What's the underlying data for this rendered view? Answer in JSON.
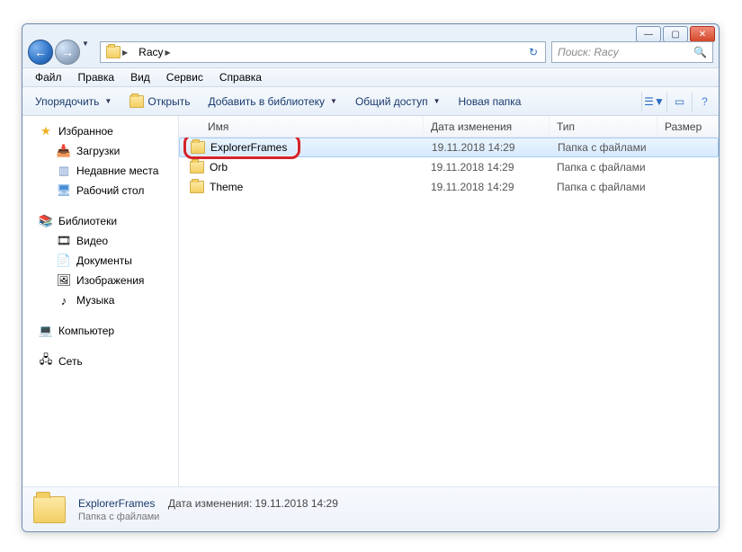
{
  "titlebar": {
    "min": "—",
    "max": "▢",
    "close": "✕"
  },
  "address": {
    "folder": "Racy",
    "refresh_glyph": "↻"
  },
  "search": {
    "placeholder": "Поиск: Racy",
    "icon": "🔍"
  },
  "menu": {
    "file": "Файл",
    "edit": "Правка",
    "view": "Вид",
    "tools": "Сервис",
    "help": "Справка"
  },
  "toolbar": {
    "organize": "Упорядочить",
    "open": "Открыть",
    "add_library": "Добавить в библиотеку",
    "share": "Общий доступ",
    "new_folder": "Новая папка"
  },
  "nav": {
    "favorites": "Избранное",
    "downloads": "Загрузки",
    "recent": "Недавние места",
    "desktop": "Рабочий стол",
    "libraries": "Библиотеки",
    "video": "Видео",
    "documents": "Документы",
    "pictures": "Изображения",
    "music": "Музыка",
    "computer": "Компьютер",
    "network": "Сеть"
  },
  "columns": {
    "name": "Имя",
    "date": "Дата изменения",
    "type": "Тип",
    "size": "Размер"
  },
  "rows": [
    {
      "name": "ExplorerFrames",
      "date": "19.11.2018 14:29",
      "type": "Папка с файлами",
      "selected": true
    },
    {
      "name": "Orb",
      "date": "19.11.2018 14:29",
      "type": "Папка с файлами",
      "selected": false
    },
    {
      "name": "Theme",
      "date": "19.11.2018 14:29",
      "type": "Папка с файлами",
      "selected": false
    }
  ],
  "details": {
    "name": "ExplorerFrames",
    "date_label": "Дата изменения:",
    "date": "19.11.2018 14:29",
    "type": "Папка с файлами"
  }
}
